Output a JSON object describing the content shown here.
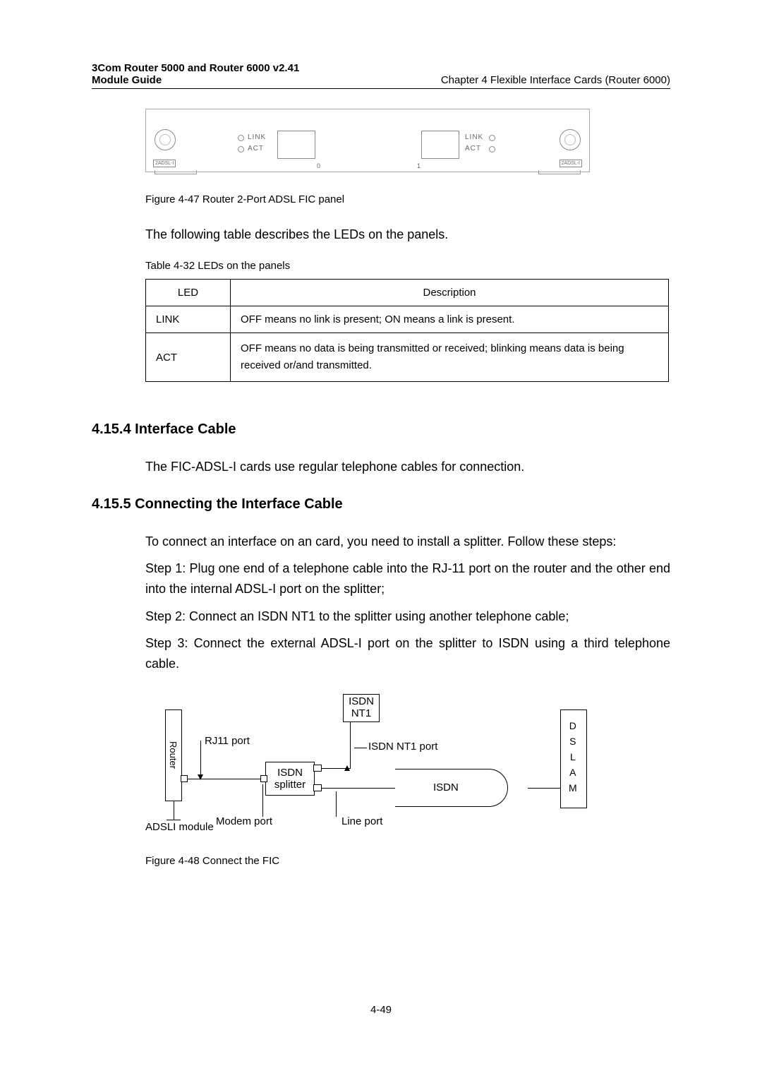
{
  "header": {
    "left_line1": "3Com Router 5000 and Router 6000 v2.41",
    "left_line2": "Module Guide",
    "right": "Chapter 4   Flexible Interface Cards (Router 6000)"
  },
  "fic_panel": {
    "label_left": "2ADSL-I",
    "label_right": "2ADSL-I",
    "led_link": "LINK",
    "led_act": "ACT",
    "port0": "0",
    "port1": "1"
  },
  "fig447": "Figure 4-47 Router 2-Port ADSL FIC panel",
  "led_intro": "The following table describes the LEDs on the panels.",
  "tbl_caption": "Table 4-32 LEDs on the panels",
  "tbl": {
    "h_led": "LED",
    "h_desc": "Description",
    "r1_led": "LINK",
    "r1_desc": "OFF means no link is present; ON means a link is present.",
    "r2_led": "ACT",
    "r2_desc": "OFF means no data is being transmitted or received; blinking means data is being received or/and transmitted."
  },
  "sec_4154": "4.15.4  Interface Cable",
  "p_4154": "The FIC-ADSL-I cards use regular telephone cables for connection.",
  "sec_4155": "4.15.5  Connecting the Interface Cable",
  "p_4155_1": "To connect an interface on an card, you need to install a splitter. Follow these steps:",
  "p_4155_2": "Step 1: Plug one end of a telephone cable into the RJ-11 port on the router and the other end into the internal ADSL-I port on the splitter;",
  "p_4155_3": "Step 2: Connect an ISDN NT1 to the splitter using another telephone cable;",
  "p_4155_4": "Step 3: Connect the external ADSL-I port on the splitter to ISDN using a third telephone cable.",
  "conn": {
    "router": "Router",
    "adsl_module": "ADSLI module",
    "rj11": "RJ11 port",
    "isdn_nt1_box": "ISDN\nNT1",
    "isdn_nt1_port": "ISDN NT1 port",
    "isdn_splitter": "ISDN\nsplitter",
    "modem_port": "Modem port",
    "line_port": "Line port",
    "isdn": "ISDN",
    "dslam": [
      "D",
      "S",
      "L",
      "A",
      "M"
    ]
  },
  "fig448": "Figure 4-48 Connect the FIC",
  "footer": "4-49"
}
